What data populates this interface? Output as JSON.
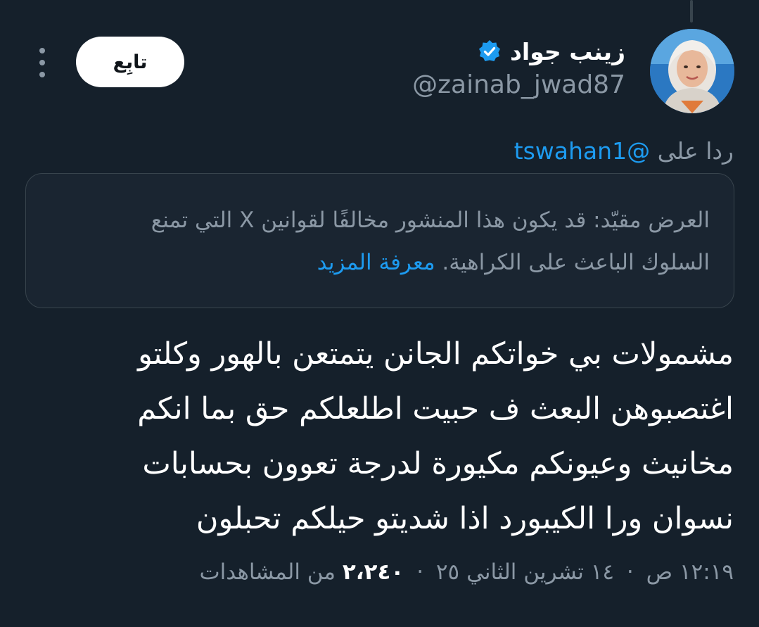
{
  "author": {
    "display_name": "زينب جواد",
    "handle": "@zainab_jwad87",
    "verified": true
  },
  "follow_button_label": "تابِع",
  "reply": {
    "label": "ردا على",
    "mention": "@tswahan1"
  },
  "notice": {
    "text": "العرض مقيّد: قد يكون هذا المنشور مخالفًا لقوانين X التي تمنع السلوك الباعث على الكراهية.",
    "link_label": "معرفة المزيد"
  },
  "tweet": {
    "lines": [
      "مشمولات بي خواتكم الجانن يتمتعن بالهور وكلتو",
      "اغتصبوهن البعث ف حبيت اطلعلكم حق بما انكم",
      "مخانيث وعيونكم مكيورة لدرجة تعوون بحسابات",
      "نسوان ورا الكيبورد اذا شديتو حيلكم تحبلون"
    ]
  },
  "meta": {
    "time": "١٢:١٩ ص",
    "date": "١٤ تشرين الثاني ٢٥",
    "views_count": "٢،٢٤٠",
    "views_label": "من المشاهدات",
    "separator": "·"
  },
  "colors": {
    "background": "#15202b",
    "text_primary": "#ffffff",
    "text_secondary": "#8b98a5",
    "accent": "#1d9bf0",
    "border": "#38444d"
  },
  "icons": {
    "verified": "verified-badge-icon",
    "more": "more-options-icon"
  }
}
